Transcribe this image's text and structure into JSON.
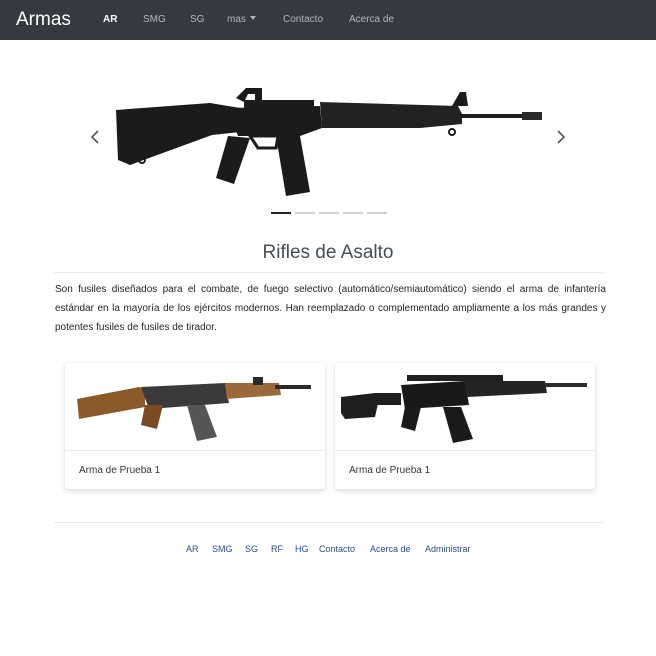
{
  "navbar": {
    "brand": "Armas",
    "items": [
      {
        "label": "AR",
        "active": true
      },
      {
        "label": "SMG"
      },
      {
        "label": "SG"
      },
      {
        "label": "mas",
        "dropdown": true
      },
      {
        "label": "Contacto"
      },
      {
        "label": "Acerca de"
      }
    ]
  },
  "carousel": {
    "image": "m16-rifle",
    "slide_count": 5,
    "active_slide": 1,
    "prev_icon": "chevron-left-icon",
    "next_icon": "chevron-right-icon"
  },
  "section": {
    "title": "Rifles de Asalto",
    "description": "Son fusiles diseñados para el combate, de fuego selectivo (automático/semiautomático) siendo el arma de infantería estándar en la mayoría de los ejércitos modernos. Han reemplazado o complementado ampliamente a los más grandes y potentes fusiles de fusiles de tirador."
  },
  "cards": [
    {
      "title": "Arma de Prueba 1",
      "image": "ak47-rifle"
    },
    {
      "title": "Arma de Prueba 1",
      "image": "ak12-rifle"
    }
  ],
  "footer": {
    "links": [
      "AR",
      "SMG",
      "SG",
      "RF",
      "HG",
      "Contacto",
      "Acerca de",
      "Administrar"
    ]
  },
  "colors": {
    "navbar_bg": "#343a40",
    "link": "#2b4c7e"
  }
}
